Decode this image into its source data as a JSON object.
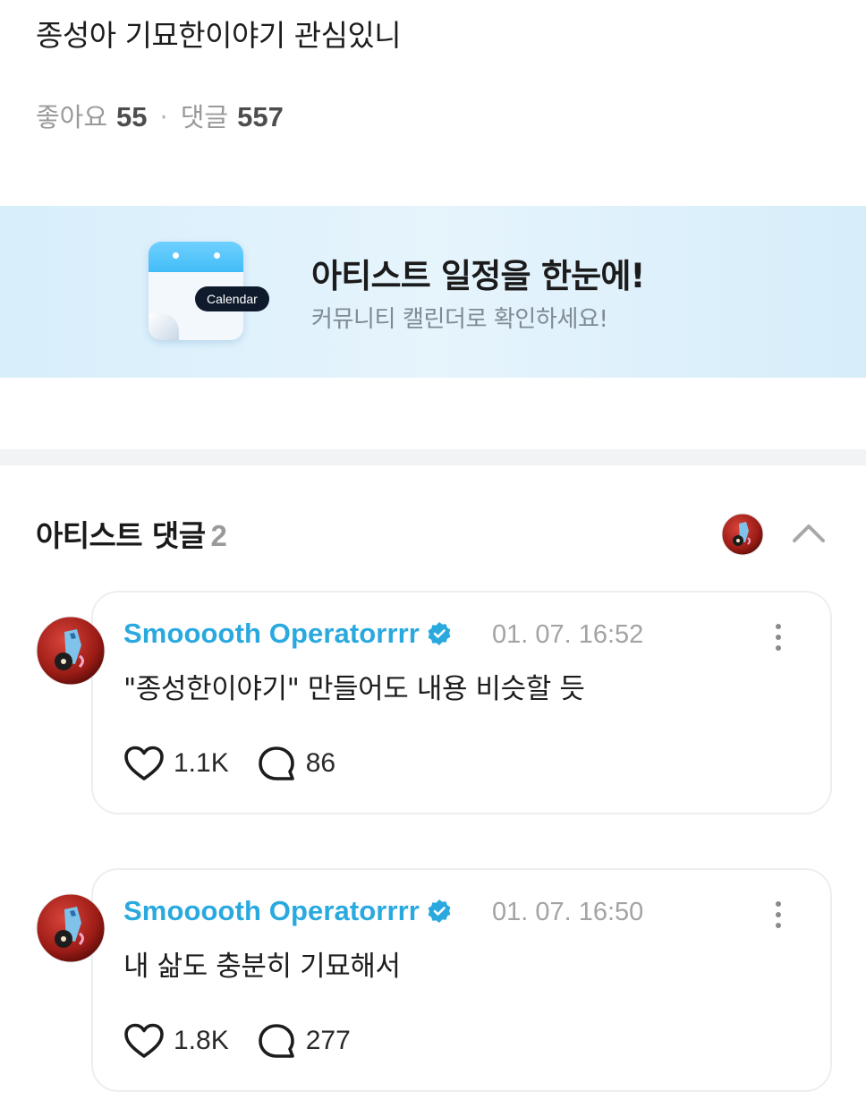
{
  "post": {
    "title": "종성아 기묘한이야기 관심있니",
    "likes_label": "좋아요",
    "likes_count": "55",
    "comments_label": "댓글",
    "comments_count": "557",
    "separator": "·"
  },
  "banner": {
    "icon_label": "Calendar",
    "title": "아티스트 일정을 한눈에!",
    "subtitle": "커뮤니티 캘린더로 확인하세요!",
    "icon": "calendar-icon"
  },
  "artist_comments": {
    "title": "아티스트 댓글",
    "count": "2",
    "collapse_icon": "chevron-up-icon"
  },
  "comments": [
    {
      "author": "Smooooth Operatorrrr",
      "verified": true,
      "time": "01. 07. 16:52",
      "text": "\"종성한이야기\" 만들어도 내용 비슷할 듯",
      "likes": "1.1K",
      "replies": "86"
    },
    {
      "author": "Smooooth Operatorrrr",
      "verified": true,
      "time": "01. 07. 16:50",
      "text": "내 삶도 충분히 기묘해서",
      "likes": "1.8K",
      "replies": "277"
    }
  ],
  "colors": {
    "author": "#2aa9df",
    "verified_badge": "#2aa9df",
    "banner_bg": "#dff1fb",
    "muted": "#9a9a9a"
  }
}
